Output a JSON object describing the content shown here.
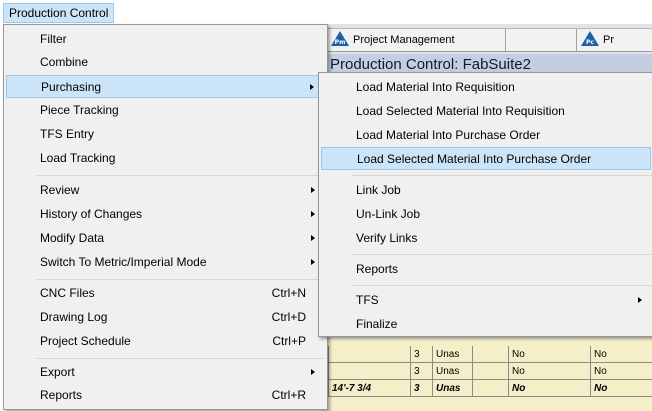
{
  "menubar": {
    "title": "Production Control"
  },
  "background": {
    "tabs": [
      {
        "label": "Project Management",
        "icon": "pm-icon",
        "icon_text": "Pm"
      },
      {
        "label": "Pr",
        "icon": "pc-icon",
        "icon_text": "Pc"
      }
    ],
    "window_title": "Production Control: FabSuite2",
    "grid_rows": [
      {
        "length": "",
        "qty": "3",
        "status": "Unas",
        "col_a": "No",
        "col_b": "No"
      },
      {
        "length": "",
        "qty": "3",
        "status": "Unas",
        "col_a": "No",
        "col_b": "No"
      },
      {
        "length": "14'-7 3/4",
        "qty": "3",
        "status": "Unas",
        "col_a": "No",
        "col_b": "No"
      }
    ]
  },
  "main_menu": {
    "items": [
      {
        "label": "Filter",
        "shortcut": "",
        "submenu": false
      },
      {
        "label": "Combine",
        "shortcut": "",
        "submenu": false
      },
      {
        "label": "Purchasing",
        "shortcut": "",
        "submenu": true,
        "highlighted": true
      },
      {
        "label": "Piece Tracking",
        "shortcut": "",
        "submenu": false
      },
      {
        "label": "TFS Entry",
        "shortcut": "",
        "submenu": false
      },
      {
        "label": "Load Tracking",
        "shortcut": "",
        "submenu": false
      },
      {
        "label": "Review",
        "shortcut": "",
        "submenu": true
      },
      {
        "label": "History of Changes",
        "shortcut": "",
        "submenu": true
      },
      {
        "label": "Modify Data",
        "shortcut": "",
        "submenu": true
      },
      {
        "label": "Switch To Metric/Imperial Mode",
        "shortcut": "",
        "submenu": true
      },
      {
        "label": "CNC Files",
        "shortcut": "Ctrl+N",
        "submenu": false
      },
      {
        "label": "Drawing Log",
        "shortcut": "Ctrl+D",
        "submenu": false
      },
      {
        "label": "Project Schedule",
        "shortcut": "Ctrl+P",
        "submenu": false
      },
      {
        "label": "Export",
        "shortcut": "",
        "submenu": true
      },
      {
        "label": "Reports",
        "shortcut": "Ctrl+R",
        "submenu": false
      }
    ]
  },
  "sub_menu": {
    "items": [
      {
        "label": "Load Material Into Requisition",
        "submenu": false
      },
      {
        "label": "Load Selected Material Into Requisition",
        "submenu": false
      },
      {
        "label": "Load Material Into Purchase Order",
        "submenu": false
      },
      {
        "label": "Load Selected Material Into Purchase Order",
        "submenu": false,
        "highlighted": true
      },
      {
        "label": "Link Job",
        "submenu": false
      },
      {
        "label": "Un-Link Job",
        "submenu": false
      },
      {
        "label": "Verify Links",
        "submenu": false
      },
      {
        "label": "Reports",
        "submenu": false
      },
      {
        "label": "TFS",
        "submenu": true
      },
      {
        "label": "Finalize",
        "submenu": false
      }
    ]
  },
  "colors": {
    "highlight": "#cce4f7",
    "highlight_border": "#99c9ef",
    "menu_bg": "#f0f0f0",
    "grid_bg": "#f5efc9"
  }
}
